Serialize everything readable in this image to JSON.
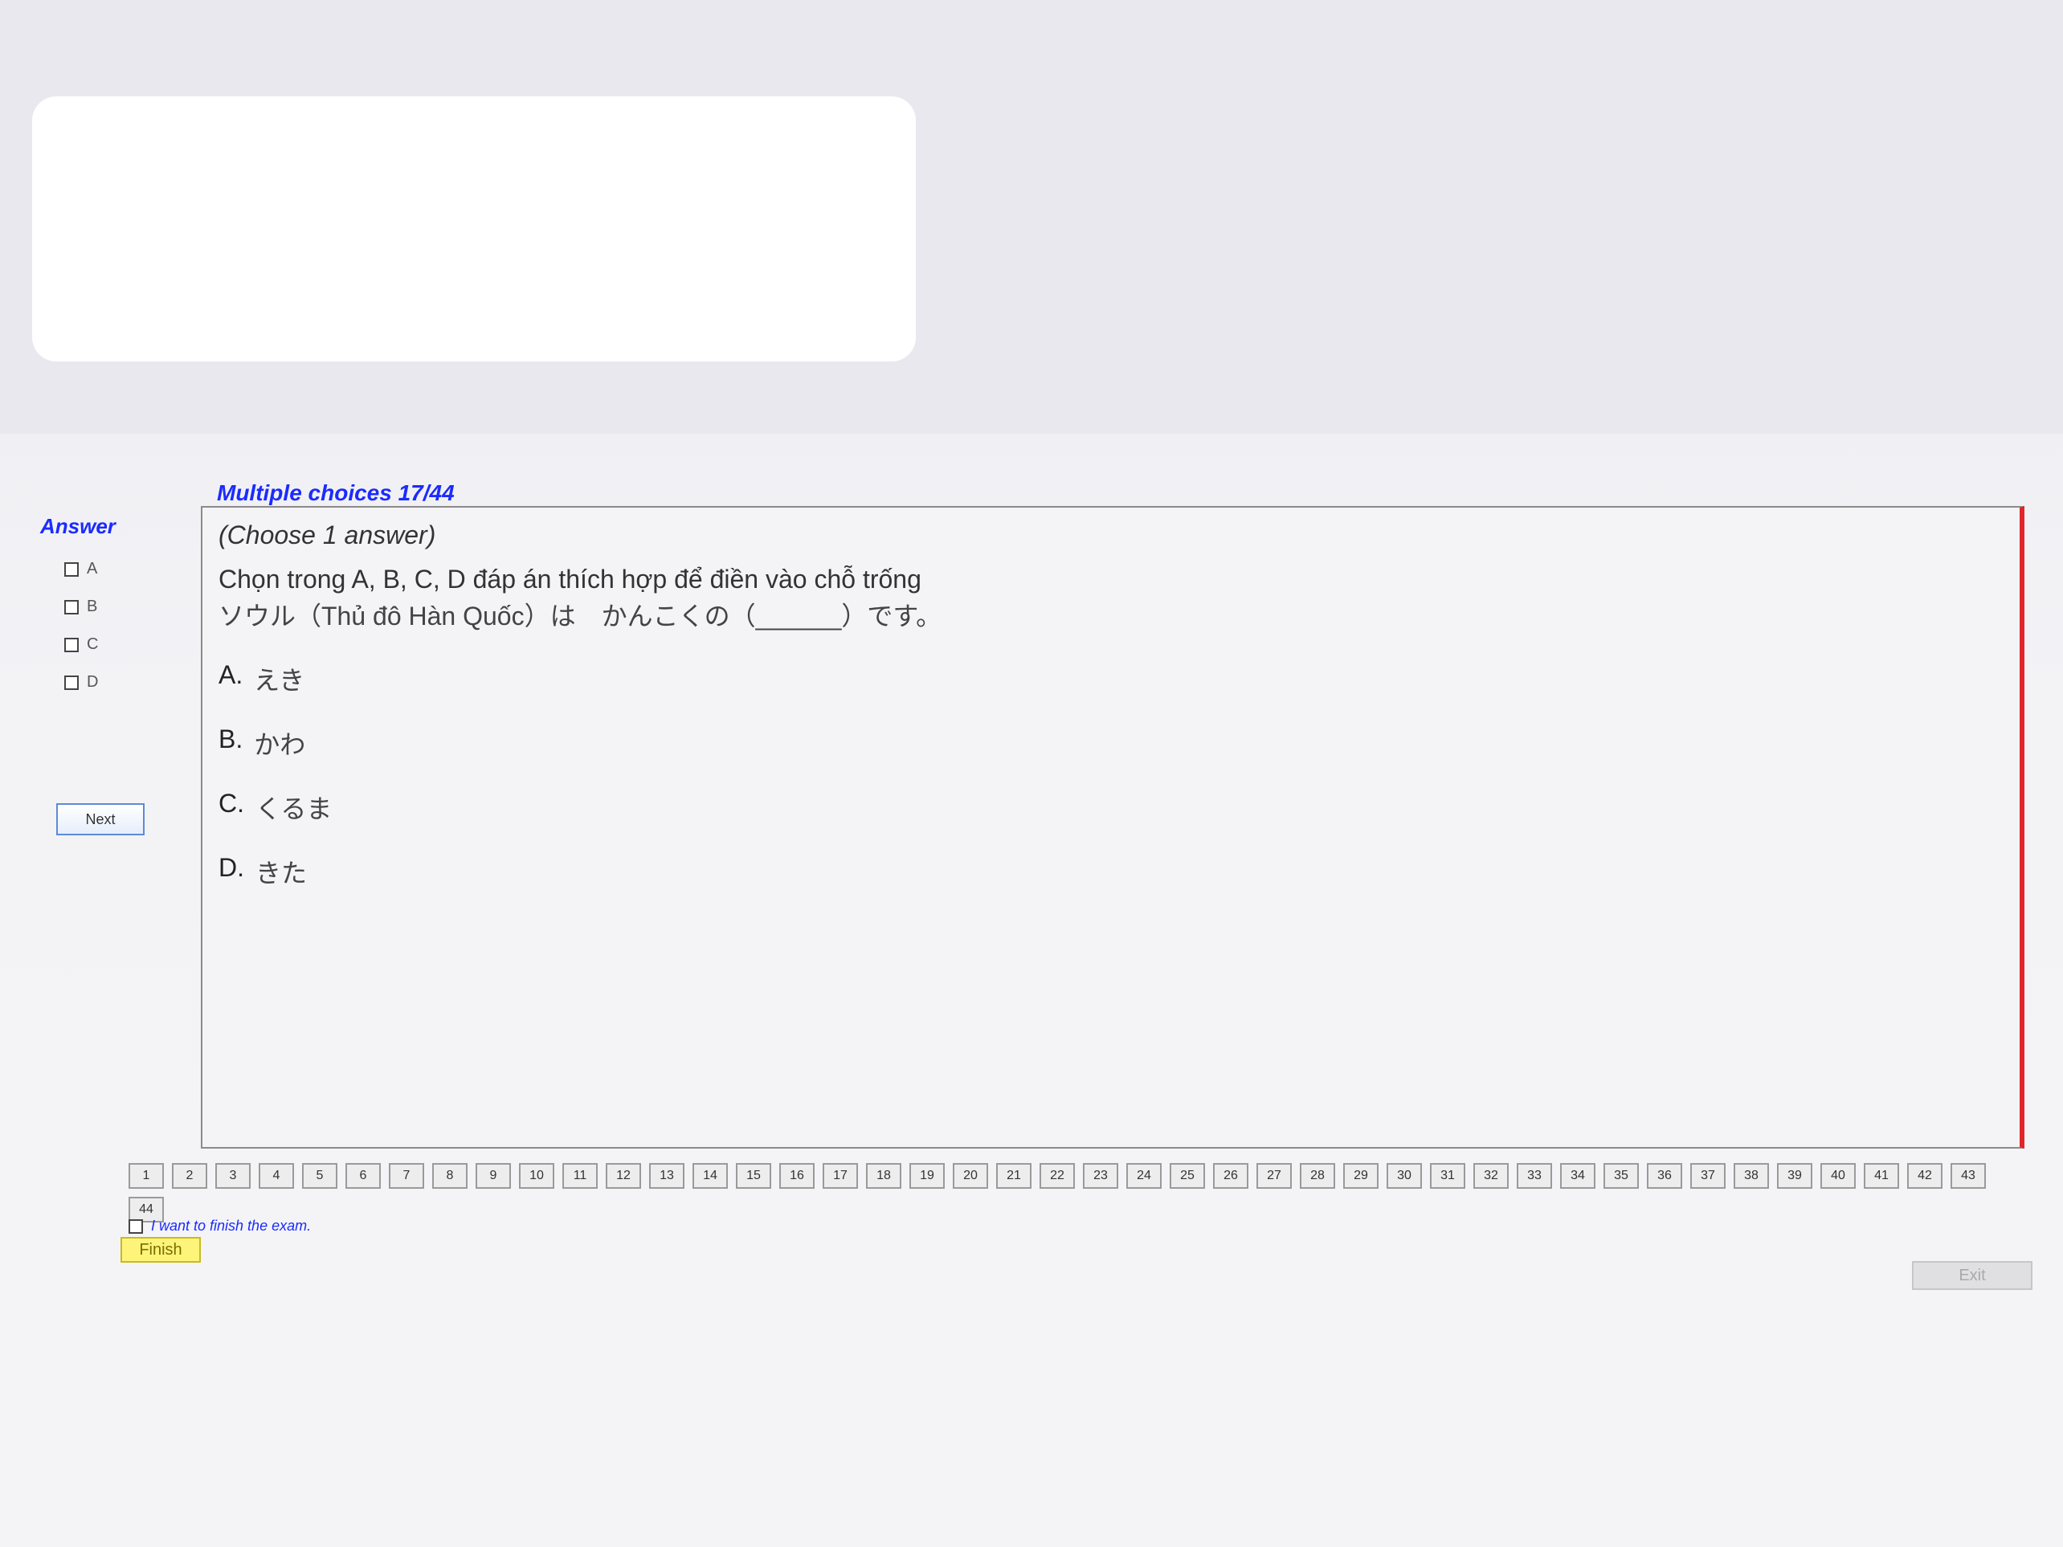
{
  "question_header": "Multiple choices 17/44",
  "answer_panel": {
    "title": "Answer",
    "options": [
      "A",
      "B",
      "C",
      "D"
    ],
    "next_label": "Next"
  },
  "content": {
    "choose_line": "(Choose 1 answer)",
    "instruction": "Chọn trong A, B, C, D đáp án thích hợp để điền vào chỗ trống",
    "sentence": "ソウル（Thủ đô Hàn Quốc）は　かんこくの（______）です。",
    "options": [
      {
        "letter": "A.",
        "text": "えき"
      },
      {
        "letter": "B.",
        "text": "かわ"
      },
      {
        "letter": "C.",
        "text": "くるま"
      },
      {
        "letter": "D.",
        "text": "きた"
      }
    ]
  },
  "nav": {
    "questions": [
      "1",
      "2",
      "3",
      "4",
      "5",
      "6",
      "7",
      "8",
      "9",
      "10",
      "11",
      "12",
      "13",
      "14",
      "15",
      "16",
      "17",
      "18",
      "19",
      "20",
      "21",
      "22",
      "23",
      "24",
      "25",
      "26",
      "27",
      "28",
      "29",
      "30",
      "31",
      "32",
      "33",
      "34",
      "35",
      "36",
      "37",
      "38",
      "39",
      "40",
      "41",
      "42",
      "43",
      "44"
    ],
    "finish_checkbox_label": "I want to finish the exam.",
    "finish_label": "Finish",
    "exit_label": "Exit"
  },
  "colors": {
    "header_blue": "#1b2bff",
    "right_border_red": "#e0262b",
    "finish_yellow": "#fff47a"
  }
}
